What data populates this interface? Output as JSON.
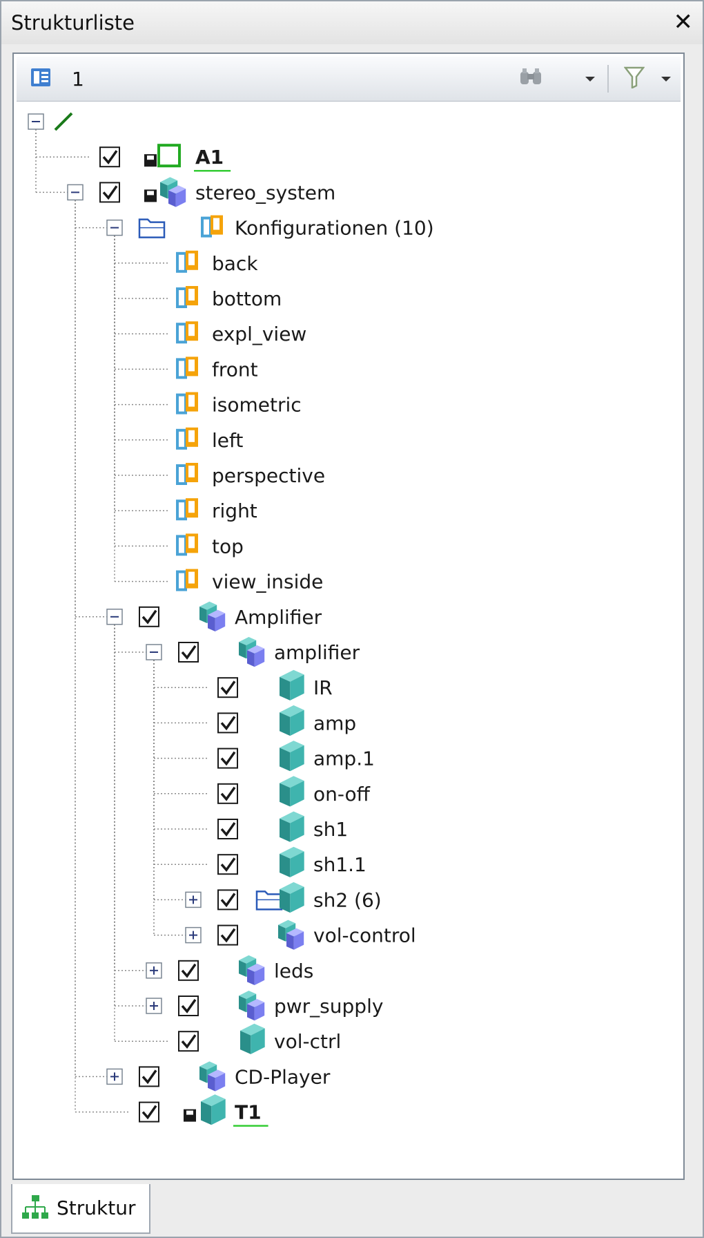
{
  "window": {
    "title": "Strukturliste",
    "close_icon": "close-icon"
  },
  "toolbar": {
    "doc_icon": "document-list-icon",
    "number": "1",
    "search_icon": "binoculars-icon",
    "filter_icon": "filter-icon"
  },
  "tree": [
    {
      "label": "",
      "level": 0,
      "expander": "minus",
      "icon": "line-icon"
    },
    {
      "label": "A1",
      "level": 1,
      "expander": "none",
      "checked": true,
      "saved": true,
      "icon": "frame-icon",
      "bold": true,
      "underline": true
    },
    {
      "label": "stereo_system",
      "level": 1,
      "expander": "minus",
      "checked": true,
      "saved": true,
      "icon": "assembly-icon"
    },
    {
      "label": "Konfigurationen (10)",
      "level": 2,
      "expander": "minus",
      "folder": true,
      "icon": "config-icon"
    },
    {
      "label": "back",
      "level": 3,
      "expander": "none",
      "icon": "config-icon"
    },
    {
      "label": "bottom",
      "level": 3,
      "expander": "none",
      "icon": "config-icon"
    },
    {
      "label": "expl_view",
      "level": 3,
      "expander": "none",
      "icon": "config-icon"
    },
    {
      "label": "front",
      "level": 3,
      "expander": "none",
      "icon": "config-icon"
    },
    {
      "label": "isometric",
      "level": 3,
      "expander": "none",
      "icon": "config-icon"
    },
    {
      "label": "left",
      "level": 3,
      "expander": "none",
      "icon": "config-icon"
    },
    {
      "label": "perspective",
      "level": 3,
      "expander": "none",
      "icon": "config-icon"
    },
    {
      "label": "right",
      "level": 3,
      "expander": "none",
      "icon": "config-icon"
    },
    {
      "label": "top",
      "level": 3,
      "expander": "none",
      "icon": "config-icon"
    },
    {
      "label": "view_inside",
      "level": 3,
      "expander": "none",
      "icon": "config-icon"
    },
    {
      "label": "Amplifier",
      "level": 2,
      "expander": "minus",
      "checked": true,
      "icon": "assembly-icon"
    },
    {
      "label": "amplifier",
      "level": 3,
      "expander": "minus",
      "checked": true,
      "icon": "assembly-icon"
    },
    {
      "label": "IR",
      "level": 4,
      "expander": "none",
      "checked": true,
      "icon": "part-icon"
    },
    {
      "label": "amp",
      "level": 4,
      "expander": "none",
      "checked": true,
      "icon": "part-icon"
    },
    {
      "label": "amp.1",
      "level": 4,
      "expander": "none",
      "checked": true,
      "icon": "part-icon"
    },
    {
      "label": "on-off",
      "level": 4,
      "expander": "none",
      "checked": true,
      "icon": "part-icon"
    },
    {
      "label": "sh1",
      "level": 4,
      "expander": "none",
      "checked": true,
      "icon": "part-icon"
    },
    {
      "label": "sh1.1",
      "level": 4,
      "expander": "none",
      "checked": true,
      "icon": "part-icon"
    },
    {
      "label": "sh2 (6)",
      "level": 4,
      "expander": "plus",
      "checked": true,
      "folder": true,
      "icon": "part-icon"
    },
    {
      "label": "vol-control",
      "level": 4,
      "expander": "plus",
      "checked": true,
      "icon": "assembly-icon"
    },
    {
      "label": "leds",
      "level": 3,
      "expander": "plus",
      "checked": true,
      "icon": "assembly-icon"
    },
    {
      "label": "pwr_supply",
      "level": 3,
      "expander": "plus",
      "checked": true,
      "icon": "assembly-icon"
    },
    {
      "label": "vol-ctrl",
      "level": 3,
      "expander": "none",
      "checked": true,
      "icon": "part-icon"
    },
    {
      "label": "CD-Player",
      "level": 2,
      "expander": "plus",
      "checked": true,
      "icon": "assembly-icon"
    },
    {
      "label": "T1",
      "level": 2,
      "expander": "none",
      "checked": true,
      "saved": true,
      "icon": "part-icon",
      "bold": true,
      "underline": true
    }
  ],
  "tab": {
    "label": "Struktur",
    "icon": "structure-tree-icon"
  },
  "colors": {
    "tree_line": "#8a8a8a",
    "config_blue": "#4aa3d6",
    "config_orange": "#f5a30a",
    "part_teal": "#3fb4ae",
    "assembly_blue": "#7b7ff0",
    "underline_green": "#33cc33",
    "frame_green": "#22aa22"
  }
}
